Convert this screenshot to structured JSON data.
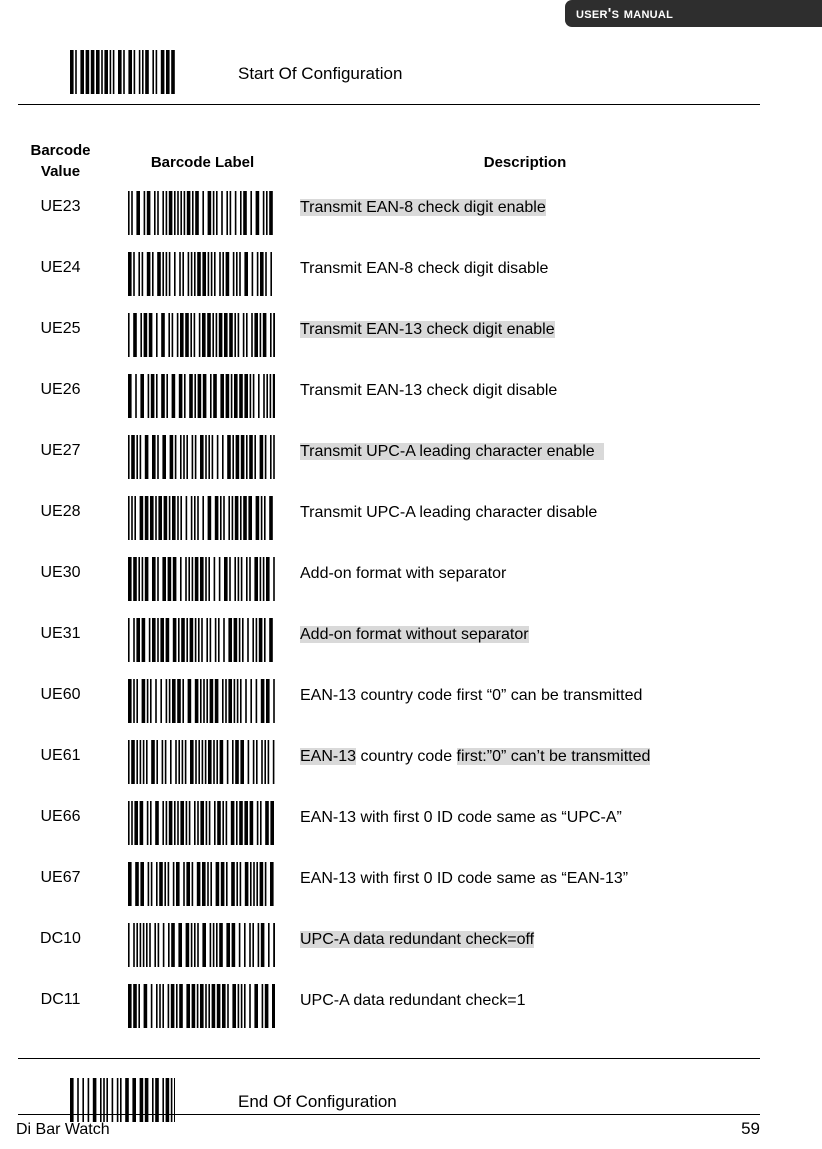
{
  "header": {
    "banner_text": "User's Manual"
  },
  "start_section": {
    "label": "Start Of Configuration",
    "barcode_icon": "barcode-symbol"
  },
  "end_section": {
    "label": "End Of Configuration",
    "barcode_icon": "barcode-symbol"
  },
  "table": {
    "headers": {
      "value_line1": "Barcode",
      "value_line2": "Value",
      "label": "Barcode Label",
      "description": "Description"
    },
    "rows": [
      {
        "value": "UE23",
        "description": "Transmit EAN-8 check digit enable",
        "segments": [
          {
            "text": "Transmit EAN-8 check digit enable",
            "highlight": true
          }
        ]
      },
      {
        "value": "UE24",
        "description": "Transmit EAN-8 check digit disable",
        "segments": [
          {
            "text": "Transmit EAN-8 check digit disable",
            "highlight": false
          }
        ]
      },
      {
        "value": "UE25",
        "description": "Transmit EAN-13 check digit enable",
        "segments": [
          {
            "text": "Transmit EAN-13 check digit enable",
            "highlight": true
          }
        ]
      },
      {
        "value": "UE26",
        "description": "Transmit EAN-13 check digit disable",
        "segments": [
          {
            "text": "Transmit EAN-13 check digit disable",
            "highlight": false
          }
        ]
      },
      {
        "value": "UE27",
        "description": "Transmit UPC-A leading character enable  ",
        "segments": [
          {
            "text": "Transmit UPC-A leading character enable  ",
            "highlight": true
          }
        ]
      },
      {
        "value": "UE28",
        "description": "Transmit UPC-A leading character disable",
        "segments": [
          {
            "text": "Transmit UPC-A leading character disable",
            "highlight": false
          }
        ]
      },
      {
        "value": "UE30",
        "description": "Add-on format with separator",
        "segments": [
          {
            "text": "Add-on format with separator",
            "highlight": false
          }
        ]
      },
      {
        "value": "UE31",
        "description": "Add-on format without separator",
        "segments": [
          {
            "text": "Add-on format without separator",
            "highlight": true
          }
        ]
      },
      {
        "value": "UE60",
        "description": "EAN-13 country code first “0” can be transmitted",
        "segments": [
          {
            "text": "EAN-13 country code first “0” can be transmitted",
            "highlight": false
          }
        ]
      },
      {
        "value": "UE61",
        "description": "EAN-13 country code first:”0” can’t be transmitted",
        "segments": [
          {
            "text": "EAN-13",
            "highlight": true
          },
          {
            "text": " country code ",
            "highlight": false
          },
          {
            "text": "first:”0” can’t be transmitted",
            "highlight": true
          }
        ]
      },
      {
        "value": "UE66",
        "description": "EAN-13 with first 0 ID code same as “UPC-A”",
        "segments": [
          {
            "text": "EAN-13 with first 0 ID code same as “UPC-A”",
            "highlight": false
          }
        ]
      },
      {
        "value": "UE67",
        "description": "EAN-13 with first 0 ID code same as “EAN-13”",
        "segments": [
          {
            "text": "EAN-13 with first 0 ID code same as “EAN-13”",
            "highlight": false
          }
        ]
      },
      {
        "value": "DC10",
        "description": "UPC-A data redundant check=off",
        "segments": [
          {
            "text": "UPC-A data redundant check=off",
            "highlight": true
          }
        ]
      },
      {
        "value": "DC11",
        "description": "UPC-A data redundant check=1",
        "segments": [
          {
            "text": "UPC-A data redundant check=1",
            "highlight": false
          }
        ]
      }
    ]
  },
  "footer": {
    "left_text": "Di Bar Watch",
    "page_number": "59"
  },
  "colors": {
    "banner_background": "#2e2e2e",
    "highlight": "#d9d9d9",
    "text": "#000000",
    "page_background": "#ffffff"
  }
}
